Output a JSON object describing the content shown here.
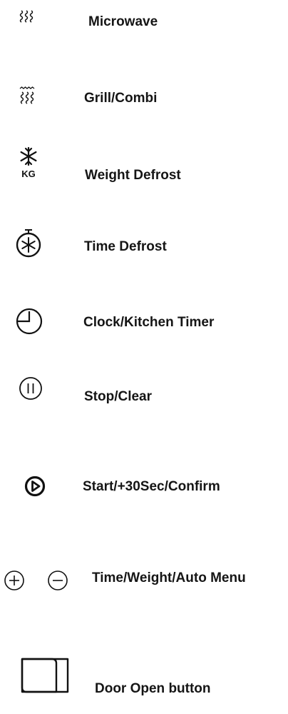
{
  "legend": [
    {
      "icon": "microwave-waves-icon",
      "label": "Microwave"
    },
    {
      "icon": "grill-combi-icon",
      "label": "Grill/Combi"
    },
    {
      "icon": "weight-defrost-icon",
      "icon_text": "KG",
      "label": "Weight Defrost"
    },
    {
      "icon": "time-defrost-icon",
      "label": "Time Defrost"
    },
    {
      "icon": "clock-icon",
      "label": "Clock/Kitchen Timer"
    },
    {
      "icon": "pause-circle-icon",
      "label": "Stop/Clear"
    },
    {
      "icon": "play-circle-icon",
      "label": "Start/+30Sec/Confirm"
    },
    {
      "icon": "plus-minus-circle-icons",
      "label": "Time/Weight/Auto Menu"
    },
    {
      "icon": "door-icon",
      "label": "Door Open button"
    }
  ],
  "colors": {
    "ink": "#111111",
    "background": "#ffffff"
  }
}
